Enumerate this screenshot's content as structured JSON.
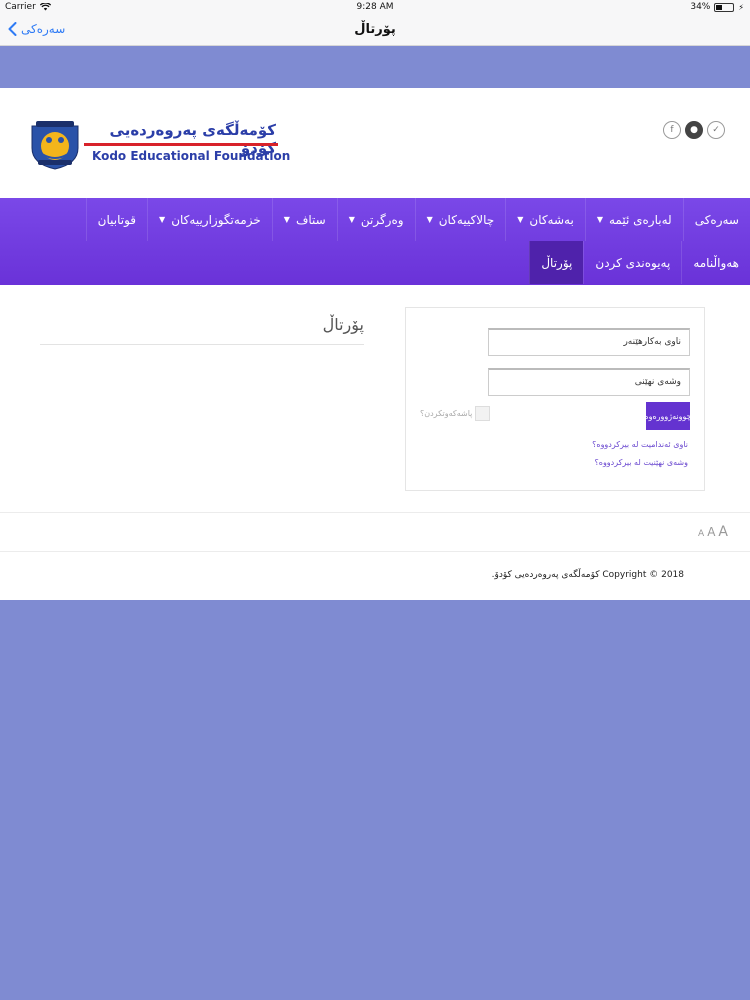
{
  "status_bar": {
    "carrier": "Carrier",
    "time": "9:28 AM",
    "battery": "34%",
    "battery_level": 0.34
  },
  "nav_bar": {
    "back_label": "سەرەکی",
    "title": "پۆرتاڵ"
  },
  "header": {
    "logo_title_ku": "کۆمەڵگەی پەروەردەیی کۆدۆ",
    "logo_title_en": "Kodo Educational Foundation",
    "social_icons": [
      "facebook-icon",
      "github-icon",
      "twitter-icon"
    ]
  },
  "menu": {
    "row1": [
      {
        "label": "سەرەکی",
        "has_dropdown": false
      },
      {
        "label": "لەبارەی ئێمە",
        "has_dropdown": true
      },
      {
        "label": "بەشەکان",
        "has_dropdown": true
      },
      {
        "label": "چالاکییەکان",
        "has_dropdown": true
      },
      {
        "label": "وەرگرتن",
        "has_dropdown": true
      },
      {
        "label": "ستاف",
        "has_dropdown": true
      },
      {
        "label": "خزمەتگوزارییەکان",
        "has_dropdown": true
      },
      {
        "label": "قوتابیان",
        "has_dropdown": false
      }
    ],
    "row2": [
      {
        "label": "هەواڵنامە",
        "active": false
      },
      {
        "label": "پەیوەندی کردن",
        "active": false
      },
      {
        "label": "پۆرتاڵ",
        "active": true
      }
    ]
  },
  "content": {
    "page_title": "پۆرتاڵ",
    "login": {
      "username_placeholder": "ناوی بەکارهێنەر",
      "password_placeholder": "وشەی نهێنی",
      "remember_label": "پاشەکەوتکردن؟",
      "login_button": "چوونەژوورەوە",
      "forgot_username": "ناوی ئەندامیت لە بیرکردووە؟",
      "forgot_password": "وشەی نهێنیت لە بیرکردووە؟"
    }
  },
  "font_resizer": [
    "A",
    "A",
    "A"
  ],
  "footer": {
    "copyright": "2018 © Copyright کۆمەڵگەی پەروەردەیی کۆدۆ."
  },
  "colors": {
    "background": "#7f8bd2",
    "menu": "#6a32d8",
    "menu_active": "#4f22ab",
    "logo_blue": "#2b3ea8",
    "logo_red": "#d8222a",
    "ios_blue": "#2f7bf5"
  }
}
